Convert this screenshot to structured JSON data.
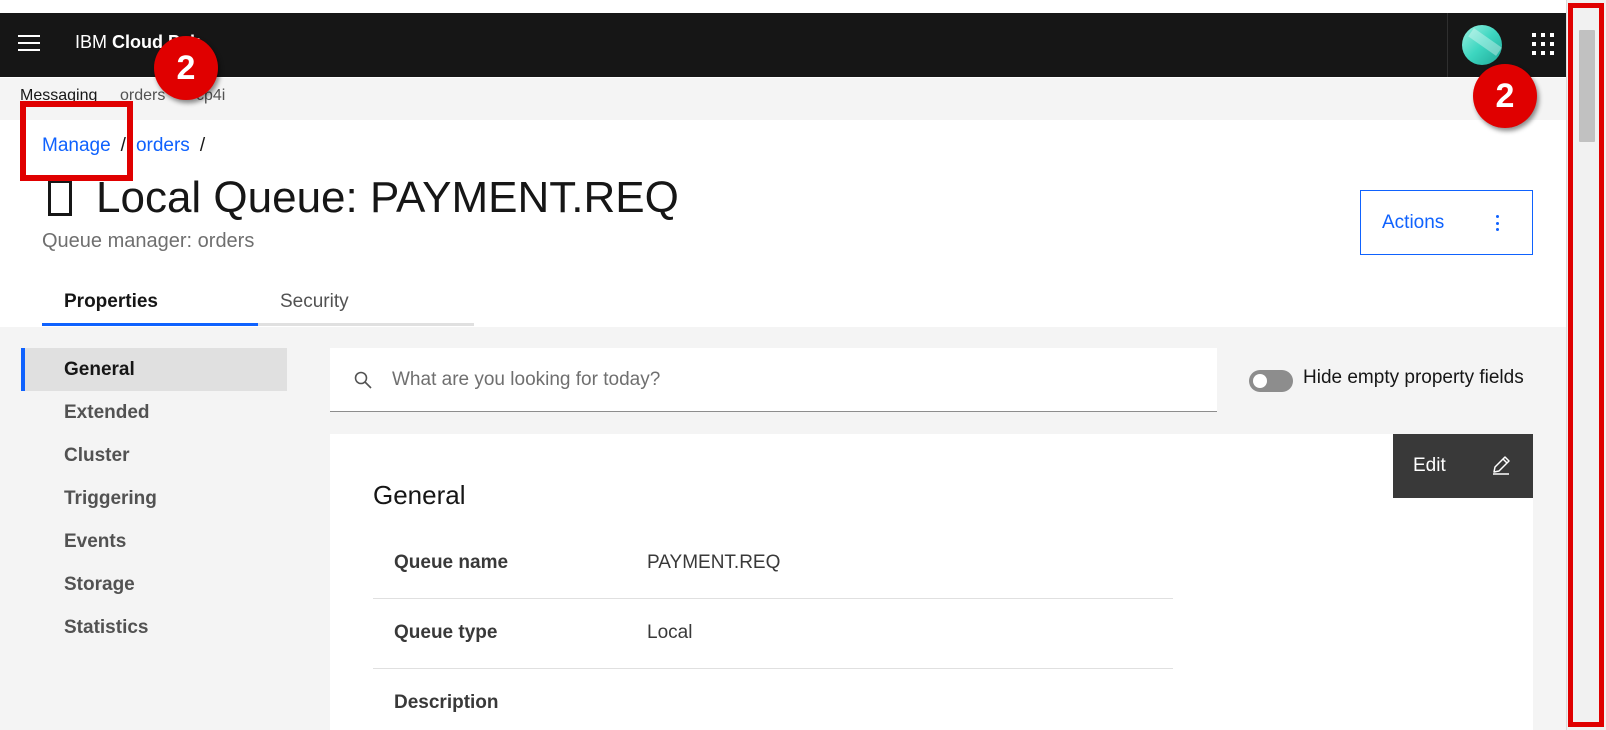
{
  "header": {
    "brand_prefix": "IBM",
    "brand_name": "Cloud Pak"
  },
  "subnav": {
    "items": [
      "Messaging",
      "orders",
      "cp4i"
    ]
  },
  "breadcrumb": {
    "items": [
      "Manage",
      "orders"
    ],
    "separator": "/"
  },
  "page": {
    "title": "Local Queue: PAYMENT.REQ",
    "subtitle": "Queue manager: orders",
    "actions_label": "Actions"
  },
  "tabs": [
    {
      "label": "Properties",
      "active": true
    },
    {
      "label": "Security",
      "active": false
    }
  ],
  "side_nav": {
    "items": [
      "General",
      "Extended",
      "Cluster",
      "Triggering",
      "Events",
      "Storage",
      "Statistics"
    ],
    "active": "General"
  },
  "search": {
    "placeholder": "What are you looking for today?"
  },
  "toggle": {
    "label": "Hide empty property fields",
    "on": false
  },
  "card": {
    "title": "General",
    "edit_label": "Edit",
    "properties": [
      {
        "label": "Queue name",
        "value": "PAYMENT.REQ"
      },
      {
        "label": "Queue type",
        "value": "Local"
      },
      {
        "label": "Description",
        "value": ""
      }
    ]
  },
  "annotations": {
    "badge_1": "2",
    "badge_2": "2"
  },
  "colors": {
    "accent": "#0f62fe",
    "header_bg": "#161616",
    "annotation_red": "#e00000"
  },
  "icons": [
    "menu-icon",
    "avatar",
    "app-switcher-icon",
    "queue-icon",
    "overflow-menu-icon",
    "search-icon",
    "edit-icon"
  ]
}
